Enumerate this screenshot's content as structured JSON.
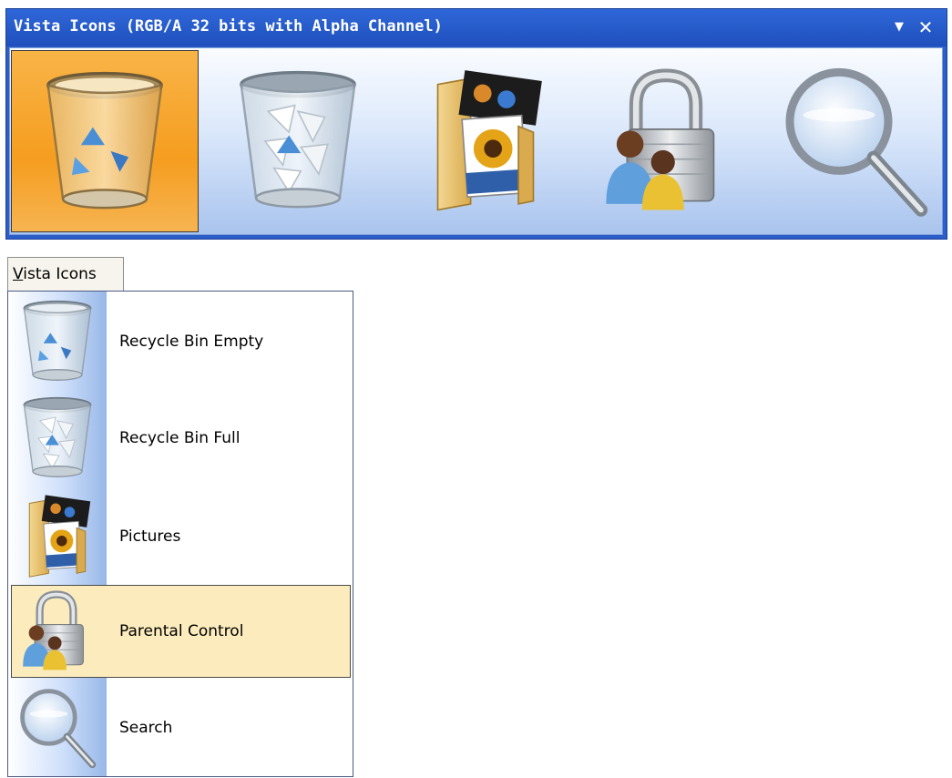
{
  "toolbar": {
    "title": "Vista Icons (RGB/A 32 bits with Alpha Channel)",
    "dropdown_glyph": "▼",
    "close_glyph": "✕",
    "buttons": [
      {
        "icon": "recycle-bin-empty-icon",
        "selected": true
      },
      {
        "icon": "recycle-bin-full-icon",
        "selected": false
      },
      {
        "icon": "pictures-folder-icon",
        "selected": false
      },
      {
        "icon": "parental-control-icon",
        "selected": false
      },
      {
        "icon": "search-icon",
        "selected": false
      }
    ]
  },
  "menu": {
    "tab_label_mnemonic": "V",
    "tab_label_rest": "ista Icons",
    "items": [
      {
        "label": "Recycle Bin Empty",
        "icon": "recycle-bin-empty-icon",
        "highlighted": false
      },
      {
        "label": "Recycle Bin Full",
        "icon": "recycle-bin-full-icon",
        "highlighted": false
      },
      {
        "label": "Pictures",
        "icon": "pictures-folder-icon",
        "highlighted": false
      },
      {
        "label": "Parental Control",
        "icon": "parental-control-icon",
        "highlighted": true
      },
      {
        "label": "Search",
        "icon": "search-icon",
        "highlighted": false
      }
    ]
  },
  "colors": {
    "title_bar": "#2c5ec9",
    "selected_button": "#f59d1f",
    "menu_highlight": "#fcecbd"
  }
}
